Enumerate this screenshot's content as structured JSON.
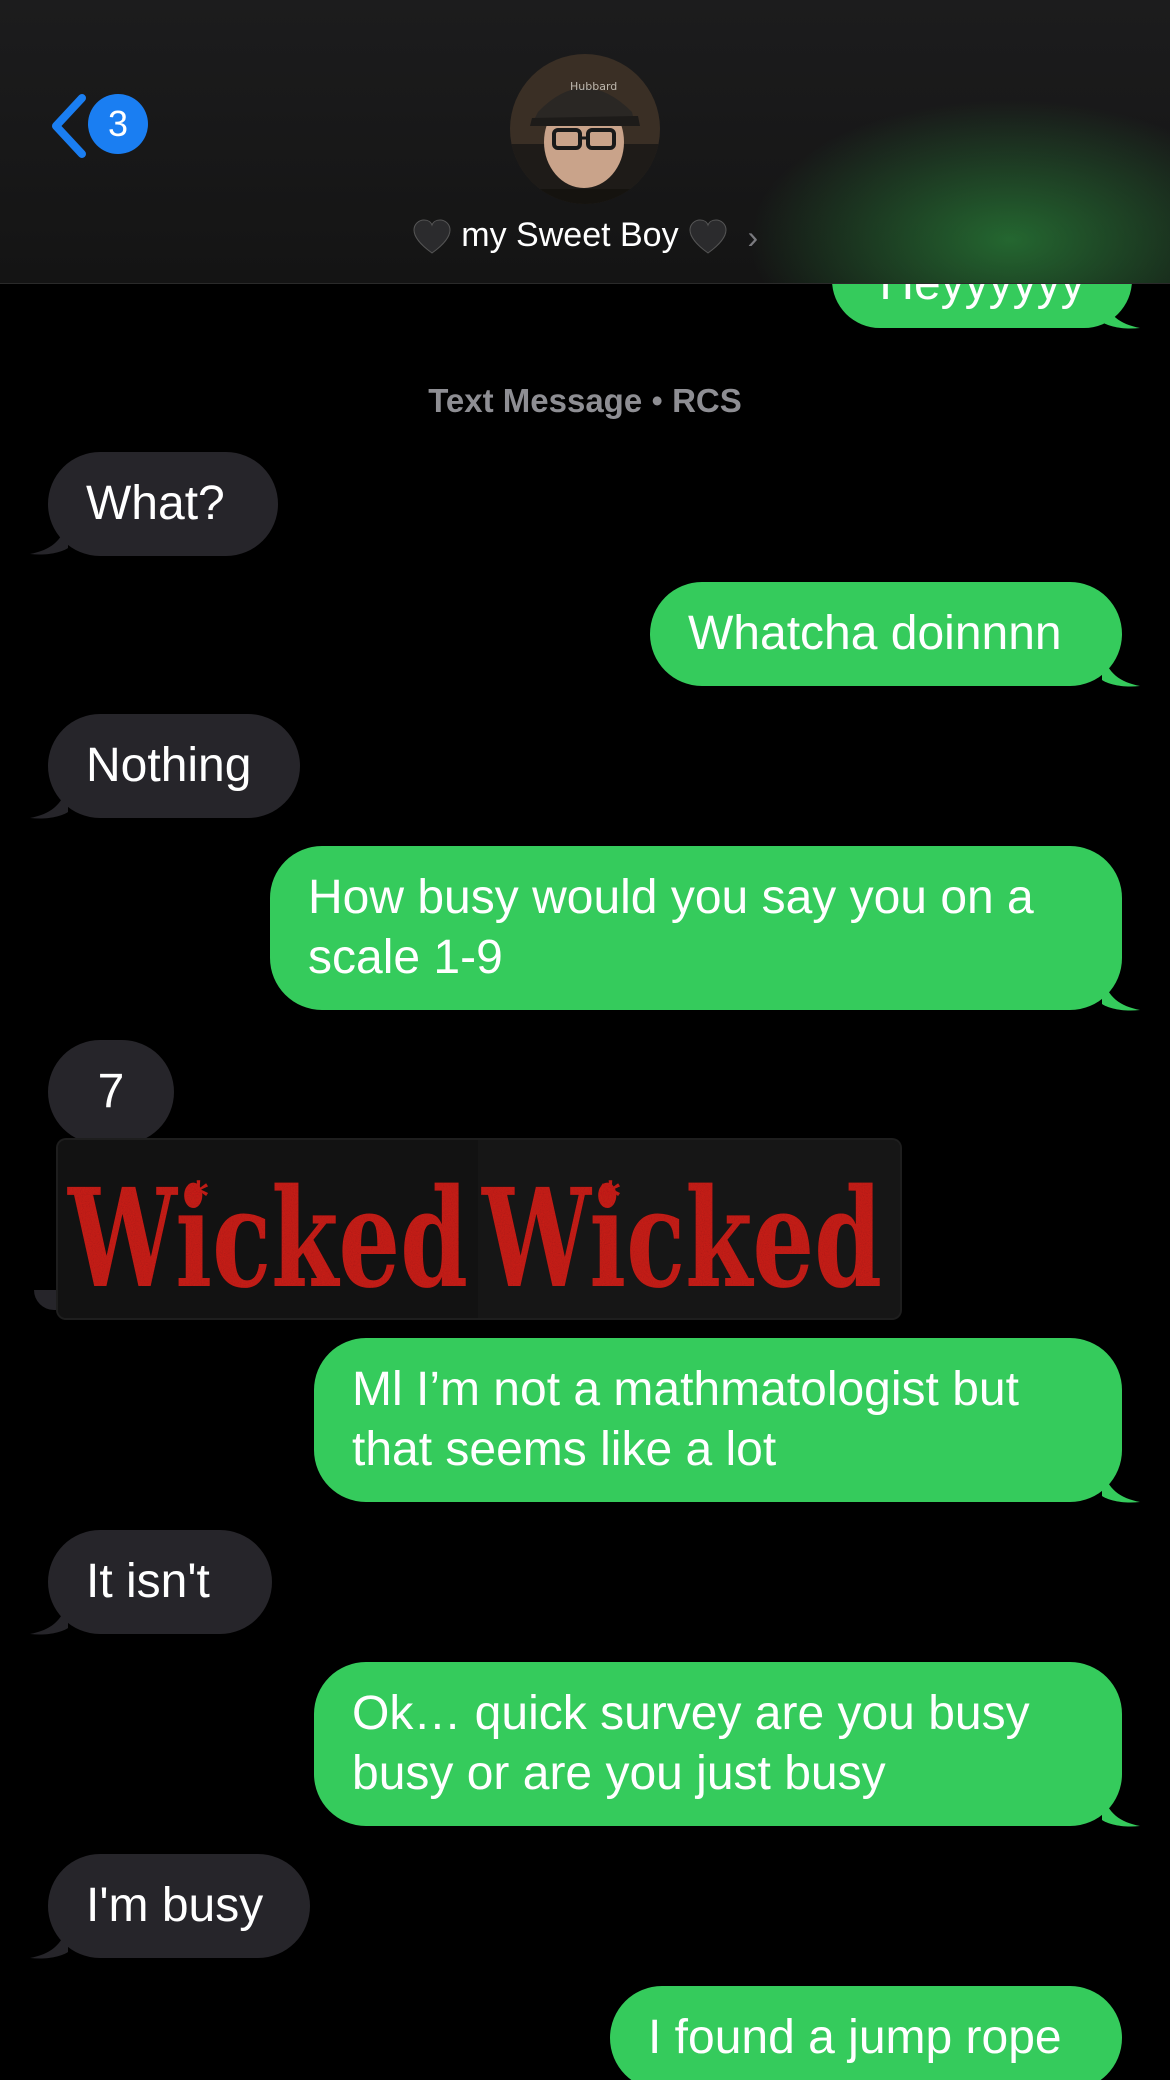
{
  "header": {
    "back_badge": "3",
    "contact_name": "my Sweet Boy",
    "avatar_cap_text": "Hubbard"
  },
  "meta": {
    "service": "Text Message",
    "separator": "•",
    "protocol": "RCS"
  },
  "messages": [
    {
      "dir": "out",
      "text": "Heyyyyyy"
    },
    {
      "dir": "in",
      "text": "What?"
    },
    {
      "dir": "out",
      "text": "Whatcha doinnnn"
    },
    {
      "dir": "in",
      "text": "Nothing"
    },
    {
      "dir": "out",
      "text": "How busy would you say you on a scale 1-9"
    },
    {
      "dir": "in",
      "text": "7"
    },
    {
      "dir": "out",
      "text": "Ml I’m not a mathmatologist but that seems like a lot"
    },
    {
      "dir": "in",
      "text": "It isn't"
    },
    {
      "dir": "out",
      "text": "Ok… quick survey are you busy busy or are you just busy"
    },
    {
      "dir": "in",
      "text": "I'm busy"
    },
    {
      "dir": "out",
      "text": "I found a jump rope"
    }
  ],
  "sticker": {
    "text_left": "Wicked",
    "text_right": "Wicked",
    "color": "#d0201c"
  },
  "colors": {
    "outgoing": "#35cb5c",
    "incoming": "#26252a",
    "badge": "#1a7ef2"
  }
}
